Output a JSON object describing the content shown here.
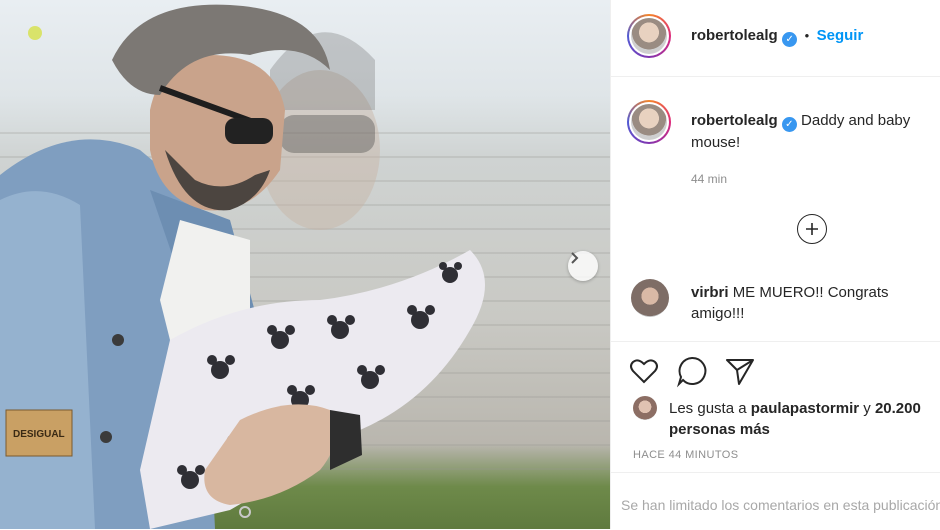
{
  "post": {
    "author": "robertolealg",
    "follow_label": "Seguir",
    "separator": "•",
    "caption_text": "Daddy and baby mouse!",
    "caption_age": "44 min",
    "verified_glyph": "✓"
  },
  "comments": [
    {
      "user": "virbri",
      "text": "ME MUERO!! Congrats amigo!!!"
    }
  ],
  "likes": {
    "prefix": "Les gusta a",
    "user": "paulapastormir",
    "suffix": "y",
    "others": "20.200 personas más"
  },
  "timestamp": "HACE 44 MINUTOS",
  "comments_limited": "Se han limitado los comentarios en esta publicación.",
  "icons": {
    "like": "heart-icon",
    "comment": "comment-icon",
    "share": "share-icon",
    "load_more": "plus-circle-icon",
    "next": "chevron-right-icon"
  },
  "colors": {
    "accent": "#0095f6",
    "verified": "#3897f0",
    "text": "#262626",
    "muted": "#8e8e8e"
  }
}
